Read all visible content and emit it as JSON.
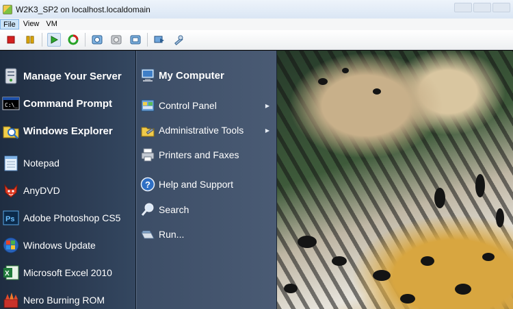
{
  "window": {
    "title": "W2K3_SP2 on localhost.localdomain"
  },
  "menubar": {
    "items": [
      "File",
      "View",
      "VM"
    ],
    "active": "File"
  },
  "toolbar": {
    "buttons": [
      "power-off",
      "suspend",
      "power-on",
      "reset",
      "snapshot",
      "revert",
      "manage-snapshots",
      "full-screen",
      "preferences"
    ]
  },
  "start_menu": {
    "pinned": [
      {
        "label": "Manage Your Server",
        "icon": "server-icon"
      },
      {
        "label": "Command Prompt",
        "icon": "cmd-icon"
      },
      {
        "label": "Windows Explorer",
        "icon": "explorer-icon"
      }
    ],
    "recent": [
      {
        "label": "Notepad",
        "icon": "notepad-icon"
      },
      {
        "label": "AnyDVD",
        "icon": "anydvd-icon"
      },
      {
        "label": "Adobe Photoshop CS5",
        "icon": "photoshop-icon"
      },
      {
        "label": "Windows Update",
        "icon": "windows-update-icon"
      },
      {
        "label": "Microsoft Excel 2010",
        "icon": "excel-icon"
      },
      {
        "label": "Nero Burning ROM",
        "icon": "nero-icon"
      }
    ],
    "right": [
      {
        "label": "My Computer",
        "icon": "computer-icon",
        "bold": true,
        "submenu": false
      },
      {
        "label": "Control Panel",
        "icon": "control-panel-icon",
        "bold": false,
        "submenu": true
      },
      {
        "label": "Administrative Tools",
        "icon": "admin-tools-icon",
        "bold": false,
        "submenu": true
      },
      {
        "label": "Printers and Faxes",
        "icon": "printer-icon",
        "bold": false,
        "submenu": false
      },
      {
        "label": "Help and Support",
        "icon": "help-icon",
        "bold": false,
        "submenu": false
      },
      {
        "label": "Search",
        "icon": "search-icon",
        "bold": false,
        "submenu": false
      },
      {
        "label": "Run...",
        "icon": "run-icon",
        "bold": false,
        "submenu": false
      }
    ]
  }
}
